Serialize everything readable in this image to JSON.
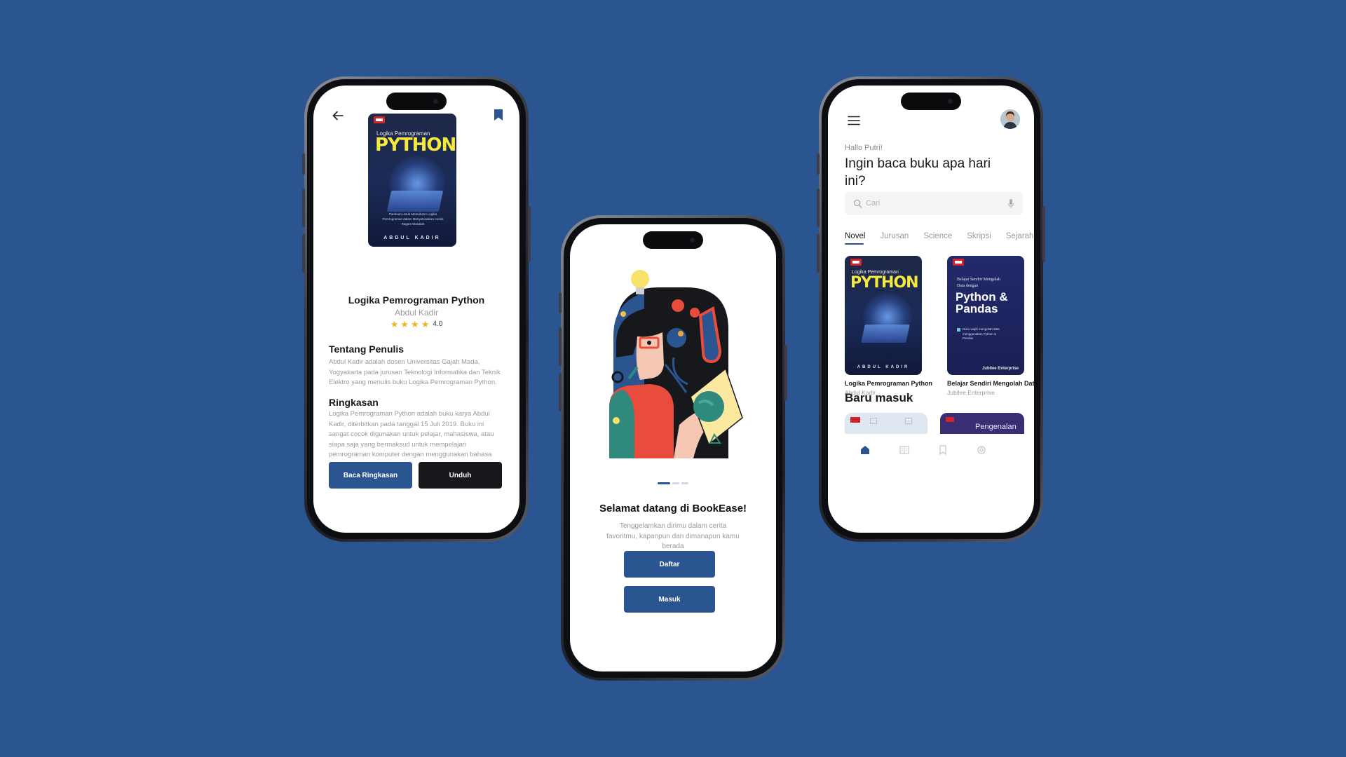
{
  "colors": {
    "background": "#2b5590",
    "primary": "#2b5590",
    "dark": "#17181c",
    "star": "#f2b61a",
    "muted": "#9a9a9a"
  },
  "detail": {
    "cover": {
      "small_title": "Logika Pemrograman",
      "title": "PYTHON",
      "subtitle": "Panduan untuk Memahami Logika Pemrograman dalam Menyelesaikan Aneka Ragam Masalah",
      "author": "ABDUL KADIR"
    },
    "title": "Logika Pemrograman Python",
    "author": "Abdul Kadir",
    "rating": {
      "stars": 4,
      "value": "4.0"
    },
    "about_heading": "Tentang Penulis",
    "about_text": "Abdul Kadir adalah dosen Universitas Gajah Mada, Yogyakarta pada jurusan Teknologi Informatika dan Teknik Elektro yang menulis buku Logika Pemrograman Python.",
    "summary_heading": "Ringkasan",
    "summary_text": "Logika Pemrograman Python adalah buku karya Abdul Kadir, diterbitkan pada tanggal 15 Juli 2019. Buku ini sangat cocok digunakan untuk pelajar, mahasiswa, atau siapa saja yang bermaksud untuk mempelajari pemrograman komputer dengan menggunakan bahasa Python...",
    "read_button": "Baca Ringkasan",
    "download_button": "Unduh",
    "icons": {
      "back": "arrow-left-icon",
      "bookmark": "bookmark-icon"
    }
  },
  "onboarding": {
    "title": "Selamat datang di BookEase!",
    "text": "Tenggelamkan dirimu dalam cerita favoritmu, kapanpun dan dimanapun kamu berada",
    "register_button": "Daftar",
    "login_button": "Masuk",
    "page_indicator": {
      "total": 3,
      "active": 1
    }
  },
  "home": {
    "greeting": "Hallo Putri!",
    "headline": "Ingin baca buku apa hari ini?",
    "search_placeholder": "Cari",
    "tabs": [
      "Novel",
      "Jurusan",
      "Science",
      "Skripsi",
      "Sejarah"
    ],
    "active_tab": "Novel",
    "books": [
      {
        "title": "Logika Pemrograman Python",
        "author": "Abdul Kadir",
        "cover_small": "Logika Pemrograman",
        "cover_title": "PYTHON",
        "cover_author": "ABDUL KADIR"
      },
      {
        "title": "Belajar Sendiri Mengolah Data",
        "author": "Jubilee Enterprise",
        "cover_small": "Belajar Sendiri Mengolah Data dengan",
        "cover_title": "Python & Pandas",
        "cover_bullet": "Buku wajib mengolah data menggunakan Python & Pandas",
        "cover_publisher": "Jubilee Enterprise"
      }
    ],
    "section_new": "Baru masuk",
    "preview_text": "Pengenalan",
    "nav": [
      "home-icon",
      "library-icon",
      "bookmark-icon",
      "settings-icon"
    ]
  }
}
